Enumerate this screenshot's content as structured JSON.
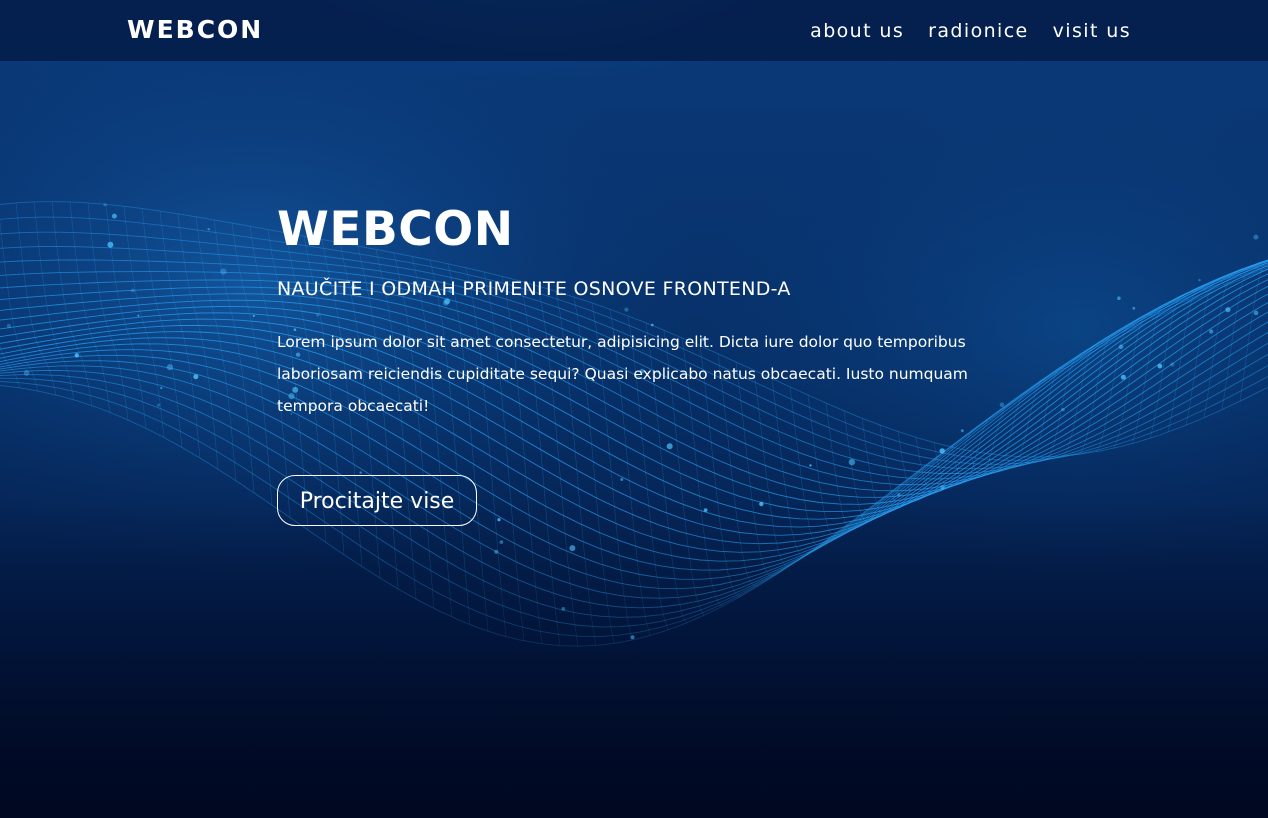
{
  "nav": {
    "brand": "WEBCON",
    "links": [
      {
        "label": "about us"
      },
      {
        "label": "radionice"
      },
      {
        "label": "visit us"
      }
    ]
  },
  "hero": {
    "title": "WEBCON",
    "subtitle": "NAUČITE I ODMAH PRIMENITE OSNOVE FRONTEND-A",
    "text": "Lorem ipsum dolor sit amet consectetur, adipisicing elit. Dicta iure dolor quo temporibus laboriosam reiciendis cupiditate sequi? Quasi explicabo natus obcaecati. Iusto numquam tempora obcaecati!",
    "button_label": "Procitajte vise"
  },
  "colors": {
    "background_dark": "#02112e",
    "background_glow": "#1a9ad8",
    "mesh_line": "#2aa8ff",
    "text": "#ffffff"
  },
  "background": {
    "image": "abstract-wave-mesh-background"
  }
}
